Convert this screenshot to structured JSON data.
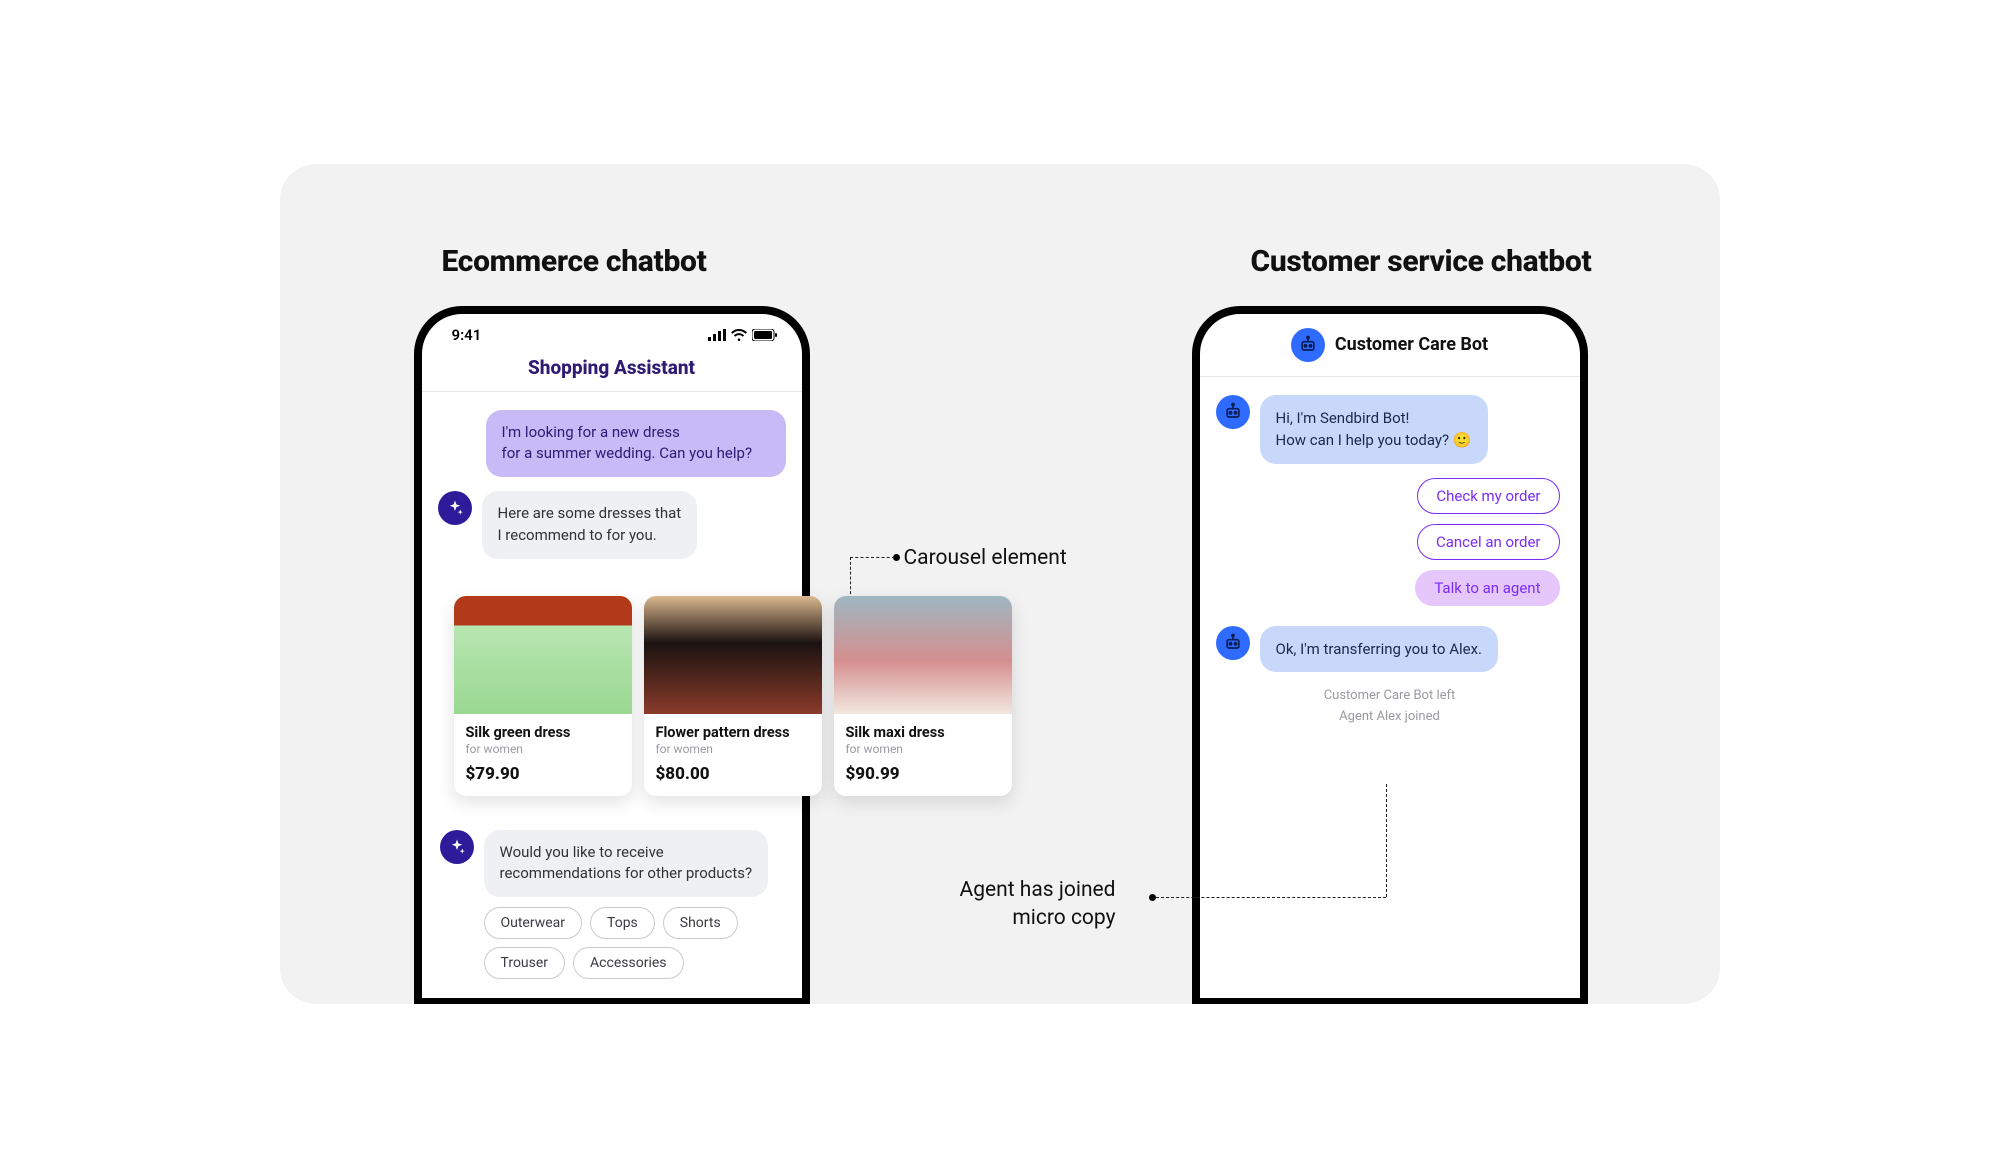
{
  "titles": {
    "left": "Ecommerce chatbot",
    "right": "Customer service chatbot"
  },
  "annotations": {
    "carousel": "Carousel element",
    "micro_line1": "Agent has joined",
    "micro_line2": "micro copy"
  },
  "left_phone": {
    "time": "9:41",
    "app_title": "Shopping Assistant",
    "user_msg_line1": "I'm looking for a new dress",
    "user_msg_line2": "for a summer wedding. Can you help?",
    "bot_msg1_line1": "Here are some dresses that",
    "bot_msg1_line2": "I recommend to for you.",
    "bot_msg2_line1": "Would you like to receive",
    "bot_msg2_line2": "recommendations for other products?",
    "chips": [
      "Outerwear",
      "Tops",
      "Shorts",
      "Trouser",
      "Accessories"
    ]
  },
  "carousel": [
    {
      "title": "Silk green dress",
      "sub": "for women",
      "price": "$79.90",
      "img_bg": "linear-gradient(180deg,#b23a1a 0%,#b23a1a 25%,#b7e6b0 25%,#9ad892 100%)"
    },
    {
      "title": "Flower pattern dress",
      "sub": "for women",
      "price": "$80.00",
      "img_bg": "linear-gradient(180deg,#dcb88f 0%, #1a1210 40%, #8a3b2a 100%)"
    },
    {
      "title": "Silk maxi dress",
      "sub": "for women",
      "price": "$90.99",
      "img_bg": "linear-gradient(180deg,#9fb7c2 0%, #d48f8f 55%, #f2e8df 100%)"
    }
  ],
  "right_phone": {
    "header_title": "Customer Care Bot",
    "bot_msg1_line1": "Hi, I'm Sendbird Bot!",
    "bot_msg1_line2": "How can I help you today? 🙂",
    "quick_replies": [
      "Check my order",
      "Cancel an order",
      "Talk to an agent"
    ],
    "bot_msg2": "Ok, I'm transferring you to Alex.",
    "system_left": "Customer Care Bot left",
    "system_join": "Agent Alex joined"
  }
}
